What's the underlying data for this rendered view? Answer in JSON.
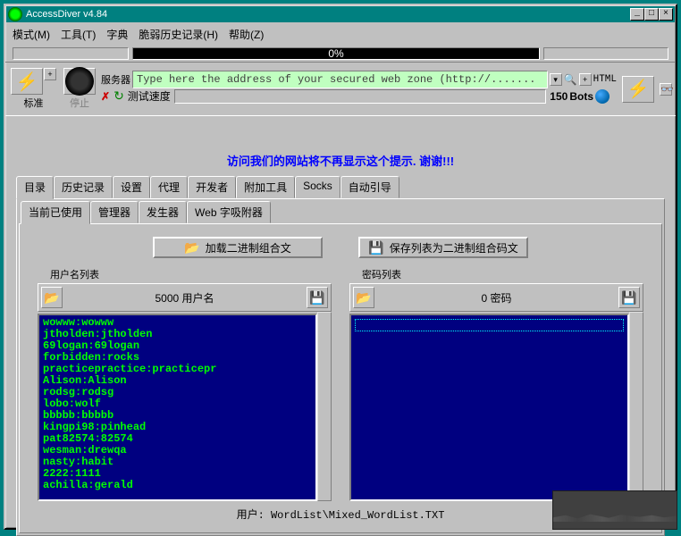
{
  "title": "AccessDiver v4.84",
  "menu": [
    "模式(M)",
    "工具(T)",
    "字典",
    "脆弱历史记录(H)",
    "帮助(Z)"
  ],
  "progress_text": "0%",
  "toolbar": {
    "standard_label": "标准",
    "stop_label": "停止",
    "server_label": "服务器",
    "address_placeholder": "Type here the address of your secured web zone (http://.......",
    "html_label": "HTML",
    "speed_label": "测试速度",
    "bots_value": "150",
    "bots_label": "Bots"
  },
  "notice": "访问我们的网站将不再显示这个提示. 谢谢!!!",
  "tabs_main": [
    "目录",
    "历史记录",
    "设置",
    "代理",
    "开发者",
    "附加工具",
    "Socks",
    "自动引导"
  ],
  "tabs_sub": [
    "当前已使用",
    "管理器",
    "发生器",
    "Web 字吸附器"
  ],
  "buttons": {
    "load_combo": "加载二进制组合文",
    "save_combo": "保存列表为二进制组合码文"
  },
  "user_list": {
    "header": "用户名列表",
    "count": "5000",
    "count_label": "用户名",
    "items": [
      "wowww:wowww",
      "jtholden:jtholden",
      "69logan:69logan",
      "forbidden:rocks",
      "practicepractice:practicepr",
      "Alison:Alison",
      "rodsg:rodsg",
      "lobo:wolf",
      "bbbbb:bbbbb",
      "kingpi98:pinhead",
      "pat82574:82574",
      "wesman:drewqa",
      "nasty:habit",
      "2222:1111",
      "achilla:gerald"
    ]
  },
  "pass_list": {
    "header": "密码列表",
    "count": "0",
    "count_label": "密码"
  },
  "status": "用户: WordList\\Mixed_WordList.TXT"
}
